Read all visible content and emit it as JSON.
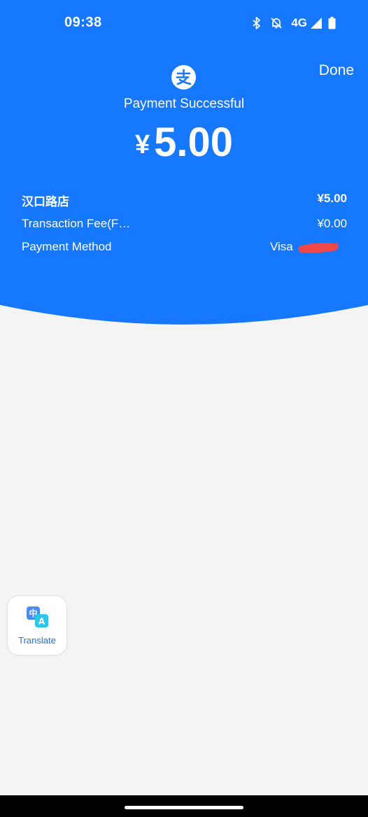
{
  "status_bar": {
    "time": "09:38",
    "network": "4G",
    "icons": [
      "bluetooth-icon",
      "notifications-off-icon",
      "signal-icon",
      "battery-icon"
    ]
  },
  "header": {
    "done_label": "Done",
    "status_text": "Payment Successful",
    "currency_symbol": "¥",
    "amount": "5.00",
    "logo_icon": "alipay-icon"
  },
  "details": [
    {
      "label": "汉口路店",
      "value": "¥5.00"
    },
    {
      "label": "Transaction Fee(F…",
      "value": "¥0.00"
    },
    {
      "label": "Payment Method",
      "value": "Visa"
    }
  ],
  "translate_widget": {
    "label": "Translate",
    "icon": "translate-icon"
  },
  "colors": {
    "primary_blue": "#1677ff",
    "background": "#f4f4f4",
    "redaction": "#f04848",
    "translate_text": "#2d6fd3"
  }
}
